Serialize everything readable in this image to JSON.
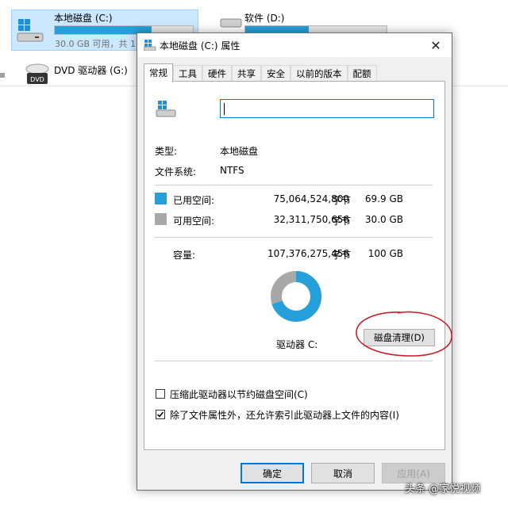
{
  "explorer": {
    "drives": [
      {
        "name": "本地磁盘 (C:)",
        "free_text": "30.0 GB 可用，共 1",
        "used_fraction": 0.7
      },
      {
        "name": "软件 (D:)",
        "used_fraction": 0.45
      },
      {
        "name": "DVD 驱动器 (G:)",
        "icon_label": "DVD"
      }
    ]
  },
  "dialog": {
    "title": "本地磁盘 (C:) 属性",
    "close_glyph": "✕",
    "tabs": [
      "常规",
      "工具",
      "硬件",
      "共享",
      "安全",
      "以前的版本",
      "配额"
    ],
    "active_tab": 0,
    "name_value": "",
    "type_label": "类型:",
    "type_value": "本地磁盘",
    "fs_label": "文件系统:",
    "fs_value": "NTFS",
    "used": {
      "label": "已用空间:",
      "bytes": "75,064,524,800",
      "unit": "字节",
      "size": "69.9 GB",
      "color": "#26a0da"
    },
    "free": {
      "label": "可用空间:",
      "bytes": "32,311,750,656",
      "unit": "字节",
      "size": "30.0 GB",
      "color": "#a8a8a8"
    },
    "capacity": {
      "label": "容量:",
      "bytes": "107,376,275,456",
      "unit": "字节",
      "size": "100 GB"
    },
    "usage_fraction": 0.699,
    "drive_label": "驱动器 C:",
    "cleanup_button": "磁盘清理(D)",
    "checkbox_compress": {
      "label": "压缩此驱动器以节约磁盘空间(C)",
      "checked": false
    },
    "checkbox_index": {
      "label": "除了文件属性外，还允许索引此驱动器上文件的内容(I)",
      "checked": true
    },
    "ok_button": "确定",
    "cancel_button": "取消",
    "apply_button": "应用(A)"
  },
  "annotation_color": "#c8202a",
  "watermark": "头条 @家悦视频"
}
